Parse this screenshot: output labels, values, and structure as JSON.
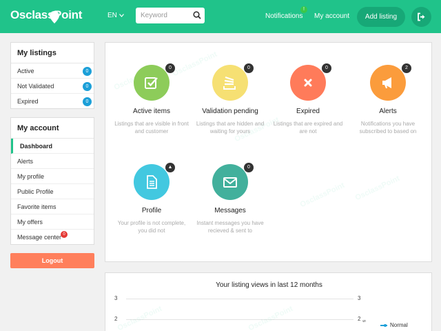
{
  "header": {
    "logo_text": "OsclassPoint",
    "language": "EN",
    "search": {
      "placeholder": "Keyword",
      "value": ""
    },
    "notifications_label": "Notifications",
    "notifications_badge": "!",
    "my_account_label": "My account",
    "add_listing_label": "Add listing"
  },
  "sidebar": {
    "my_listings": {
      "title": "My listings",
      "items": [
        {
          "label": "Active",
          "count": "0"
        },
        {
          "label": "Not Validated",
          "count": "0"
        },
        {
          "label": "Expired",
          "count": "0"
        }
      ]
    },
    "my_account": {
      "title": "My account",
      "items": [
        {
          "label": "Dashboard"
        },
        {
          "label": "Alerts"
        },
        {
          "label": "My profile"
        },
        {
          "label": "Public Profile"
        },
        {
          "label": "Favorite items"
        },
        {
          "label": "My offers"
        },
        {
          "label": "Message center",
          "badge": "0"
        }
      ]
    },
    "logout_label": "Logout"
  },
  "dashboard": {
    "tiles": [
      {
        "title": "Active items",
        "desc": "Listings that are visible in front and customer",
        "badge": "0",
        "color": "#8dcc5a",
        "icon": "check-icon"
      },
      {
        "title": "Validation pending",
        "desc": "Listings that are hidden and waiting for yours",
        "badge": "0",
        "color": "#f6e073",
        "icon": "stack-icon"
      },
      {
        "title": "Expired",
        "desc": "Listings that are expired and are not",
        "badge": "0",
        "color": "#ff7b5a",
        "icon": "close-icon"
      },
      {
        "title": "Alerts",
        "desc": "Notifications you have subscribed to based on",
        "badge": "2",
        "color": "#fb9c3c",
        "icon": "megaphone-icon"
      },
      {
        "title": "Profile",
        "desc": "Your profile is not complete, you did not",
        "badge": "▲",
        "color": "#42c8e0",
        "icon": "document-icon"
      },
      {
        "title": "Messages",
        "desc": "Instant messages you have recieved & sent to",
        "badge": "0",
        "color": "#42b09c",
        "icon": "envelope-icon"
      }
    ]
  },
  "chart_data": {
    "type": "line",
    "title": "Your listing views in last 12 months",
    "y_ticks_left": [
      "3",
      "2"
    ],
    "y_ticks_right": [
      "3",
      "2"
    ],
    "right_axis_label": "s",
    "series": [
      {
        "name": "Normal",
        "values": []
      }
    ],
    "series_color": "#1b9fd8",
    "ylim": [
      0,
      3
    ],
    "grid": true,
    "legend_position": "right"
  },
  "watermark_text": "OsclassPoint",
  "colors": {
    "brand": "#20c38a",
    "logout": "#ff7f5c",
    "count_badge": "#1b9fd8"
  }
}
